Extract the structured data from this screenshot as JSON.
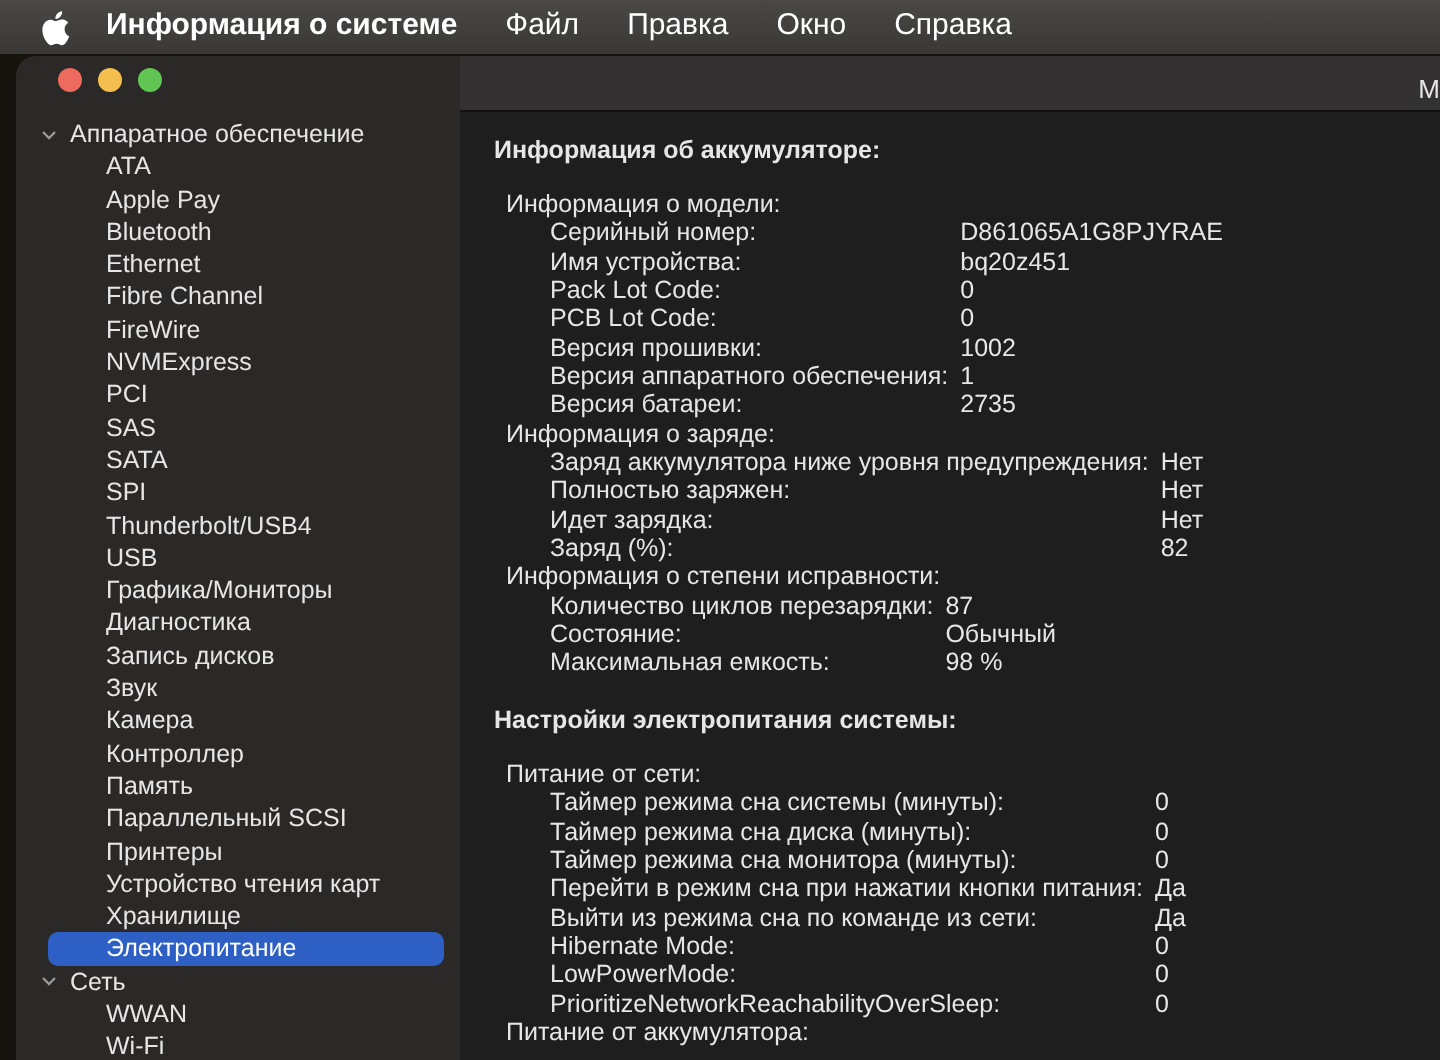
{
  "menu_bar": {
    "app_name": "Информация о системе",
    "items": [
      {
        "label": "Файл"
      },
      {
        "label": "Правка"
      },
      {
        "label": "Окно"
      },
      {
        "label": "Справка"
      }
    ]
  },
  "window": {
    "title": "M"
  },
  "sidebar": {
    "items": [
      {
        "label": "Аппаратное обеспечение",
        "expanded": true,
        "children": [
          {
            "label": "ATA",
            "selected": false
          },
          {
            "label": "Apple Pay",
            "selected": false
          },
          {
            "label": "Bluetooth",
            "selected": false
          },
          {
            "label": "Ethernet",
            "selected": false
          },
          {
            "label": "Fibre Channel",
            "selected": false
          },
          {
            "label": "FireWire",
            "selected": false
          },
          {
            "label": "NVMExpress",
            "selected": false
          },
          {
            "label": "PCI",
            "selected": false
          },
          {
            "label": "SAS",
            "selected": false
          },
          {
            "label": "SATA",
            "selected": false
          },
          {
            "label": "SPI",
            "selected": false
          },
          {
            "label": "Thunderbolt/USB4",
            "selected": false
          },
          {
            "label": "USB",
            "selected": false
          },
          {
            "label": "Графика/Мониторы",
            "selected": false
          },
          {
            "label": "Диагностика",
            "selected": false
          },
          {
            "label": "Запись дисков",
            "selected": false
          },
          {
            "label": "Звук",
            "selected": false
          },
          {
            "label": "Камера",
            "selected": false
          },
          {
            "label": "Контроллер",
            "selected": false
          },
          {
            "label": "Память",
            "selected": false
          },
          {
            "label": "Параллельный SCSI",
            "selected": false
          },
          {
            "label": "Принтеры",
            "selected": false
          },
          {
            "label": "Устройство чтения карт",
            "selected": false
          },
          {
            "label": "Хранилище",
            "selected": false
          },
          {
            "label": "Электропитание",
            "selected": true
          }
        ]
      },
      {
        "label": "Сеть",
        "expanded": true,
        "children": [
          {
            "label": "WWAN",
            "selected": false
          },
          {
            "label": "Wi-Fi",
            "selected": false
          }
        ]
      }
    ]
  },
  "content": {
    "sections": [
      {
        "title": "Информация об аккумуляторе:",
        "groups": [
          {
            "title": "Информация о модели:",
            "rows": [
              {
                "label": "Серийный номер:",
                "value": "D861065A1G8PJYRAE"
              },
              {
                "label": "Имя устройства:",
                "value": "bq20z451"
              },
              {
                "label": "Pack Lot Code:",
                "value": "0"
              },
              {
                "label": "PCB Lot Code:",
                "value": "0"
              },
              {
                "label": "Версия прошивки:",
                "value": "1002"
              },
              {
                "label": "Версия аппаратного обеспечения:",
                "value": "1"
              },
              {
                "label": "Версия батареи:",
                "value": "2735"
              }
            ]
          },
          {
            "title": "Информация о заряде:",
            "rows": [
              {
                "label": "Заряд аккумулятора ниже уровня предупреждения:",
                "value": "Нет"
              },
              {
                "label": "Полностью заряжен:",
                "value": "Нет"
              },
              {
                "label": "Идет зарядка:",
                "value": "Нет"
              },
              {
                "label": "Заряд (%):",
                "value": "82"
              }
            ]
          },
          {
            "title": "Информация о степени исправности:",
            "rows": [
              {
                "label": "Количество циклов перезарядки:",
                "value": "87"
              },
              {
                "label": "Состояние:",
                "value": "Обычный"
              },
              {
                "label": "Максимальная емкость:",
                "value": "98 %"
              }
            ]
          }
        ]
      },
      {
        "title": "Настройки электропитания системы:",
        "groups": [
          {
            "title": "Питание от сети:",
            "rows": [
              {
                "label": "Таймер режима сна системы (минуты):",
                "value": "0"
              },
              {
                "label": "Таймер режима сна диска (минуты):",
                "value": "0"
              },
              {
                "label": "Таймер режима сна монитора (минуты):",
                "value": "0"
              },
              {
                "label": "Перейти в режим сна при нажатии кнопки питания:",
                "value": "Да"
              },
              {
                "label": "Выйти из режима сна по команде из сети:",
                "value": "Да"
              },
              {
                "label": "Hibernate Mode:",
                "value": "0"
              },
              {
                "label": "LowPowerMode:",
                "value": "0"
              },
              {
                "label": "PrioritizeNetworkReachabilityOverSleep:",
                "value": "0"
              }
            ]
          },
          {
            "title": "Питание от аккумулятора:"
          }
        ]
      }
    ]
  }
}
